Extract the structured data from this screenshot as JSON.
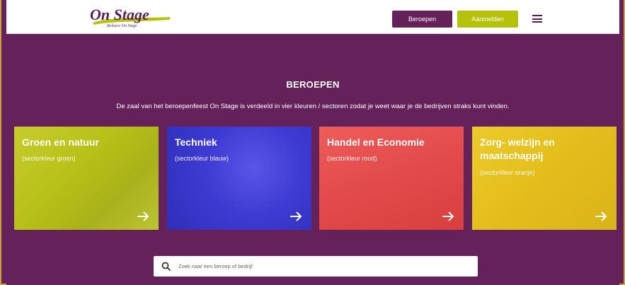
{
  "header": {
    "logo_text": "On Stage",
    "logo_subtitle": "Beleave On Stage",
    "btn_beroepen": "Beroepen",
    "btn_aanmelden": "Aanmelden",
    "menu_icon": "hamburger-icon"
  },
  "main": {
    "heading": "BEROEPEN",
    "intro": "De zaal van het beroepenfeest On Stage is verdeeld in vier kleuren / sectoren zodat je weet waar je de bedrijven straks kunt vinden.",
    "cards": [
      {
        "title": "Groen en natuur",
        "subtitle": "(sectorkleur groen)",
        "color": "#b9c21a",
        "icon": "arrow-right-icon"
      },
      {
        "title": "Techniek",
        "subtitle": "(sectorkleur blauw)",
        "color": "#3f3fd6",
        "icon": "arrow-right-icon"
      },
      {
        "title": "Handel en Economie",
        "subtitle": "(sectorkleur rood)",
        "color": "#e8504f",
        "icon": "arrow-right-icon"
      },
      {
        "title": "Zorg- welzijn en maatschappij",
        "subtitle": "(sectorkleur oranje)",
        "color": "#e6c21e",
        "icon": "arrow-right-icon"
      }
    ]
  },
  "search": {
    "placeholder": "Zoek naar een beroep of bedrijf",
    "icon": "search-icon"
  },
  "colors": {
    "brand_purple": "#64215a",
    "accent_lime": "#b5c20c"
  }
}
